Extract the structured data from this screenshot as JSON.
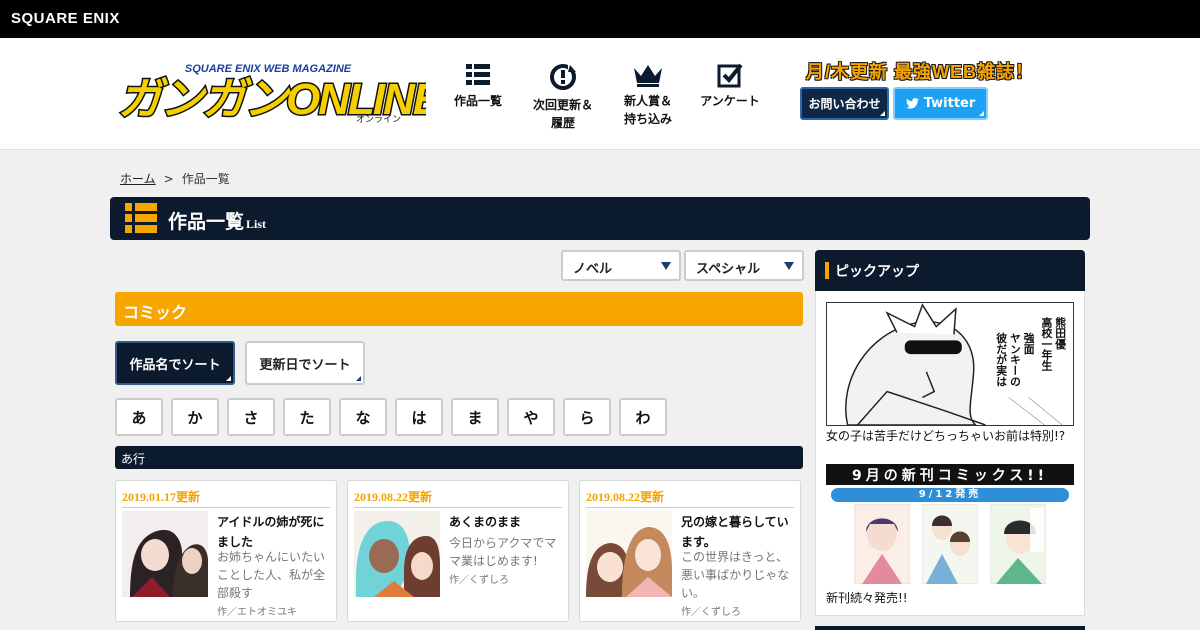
{
  "topbar": {
    "brand": "SQUARE ENIX"
  },
  "header": {
    "logo_text": "ガンガンONLINE",
    "logo_top": "SQUARE ENIX WEB MAGAZINE",
    "logo_sub": "オンライン",
    "nav": [
      {
        "label_line1": "作品一覧",
        "label_line2": "",
        "icon": "list-icon"
      },
      {
        "label_line1": "次回更新＆",
        "label_line2": "履歴",
        "icon": "refresh-clock-icon"
      },
      {
        "label_line1": "新人賞＆",
        "label_line2": "持ち込み",
        "icon": "crown-icon"
      },
      {
        "label_line1": "アンケート",
        "label_line2": "",
        "icon": "checkbox-icon"
      }
    ],
    "tagline": "月/木更新 最強WEB雑誌！",
    "contact_label": "お問い合わせ",
    "twitter_label": "Twitter"
  },
  "breadcrumb": {
    "home": "ホーム",
    "sep": ">",
    "current": "作品一覧"
  },
  "title": {
    "main": "作品一覧",
    "sub": "List"
  },
  "filters": [
    {
      "label": "ノベル"
    },
    {
      "label": "スペシャル"
    }
  ],
  "section": {
    "title": "コミック"
  },
  "sort": {
    "by_name": "作品名でソート",
    "by_date": "更新日でソート"
  },
  "kana": [
    "あ",
    "か",
    "さ",
    "た",
    "な",
    "は",
    "ま",
    "や",
    "ら",
    "わ"
  ],
  "row_label": "あ行",
  "cards": [
    {
      "date": "2019.01.17更新",
      "title": "アイドルの姉が死にました",
      "desc": "お姉ちゃんにいたいことした人、私が全部殺す",
      "author": "作／エトオミユキ"
    },
    {
      "date": "2019.08.22更新",
      "title": "あくまのまま",
      "desc": "今日からアクマでママ業はじめます!",
      "author": "作／くずしろ"
    },
    {
      "date": "2019.08.22更新",
      "title": "兄の嫁と暮らしています。",
      "desc": "この世界はきっと、悪い事ばかりじゃない。",
      "author": "作／くずしろ"
    }
  ],
  "sidebar": {
    "title": "ピックアップ",
    "pick1_caption": "女の子は苦手だけどちっちゃいお前は特別!?",
    "pick1_text": [
      "熊田優",
      "高校一年生",
      "強面",
      "ヤンキーの",
      "彼だが実は"
    ],
    "pick2_banner": "9月の新刊コミックス!!",
    "pick2_date": "9/12発売",
    "pick2_caption": "新刊続々発売!!"
  },
  "colors": {
    "navy": "#0c1a2e",
    "orange": "#f7a600",
    "twitter": "#1da1f2"
  }
}
